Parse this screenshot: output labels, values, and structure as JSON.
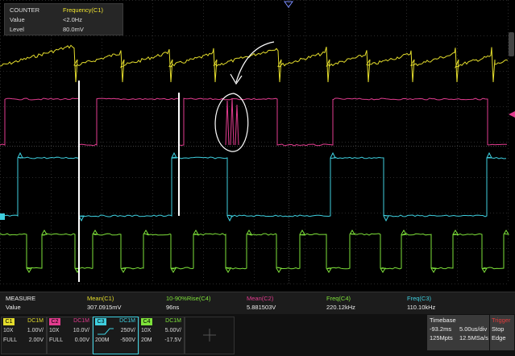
{
  "colors": {
    "c1": "#e3dc2c",
    "c2": "#e23c8f",
    "c3": "#3fd0e0",
    "c4": "#7ee23a",
    "bg": "#000000"
  },
  "counter": {
    "title": "COUNTER",
    "source": "Frequency(C1)",
    "value_label": "Value",
    "value": "<2.0Hz",
    "level_label": "Level",
    "level": "80.0mV"
  },
  "measure": {
    "title": "MEASURE",
    "row_label": "Value",
    "items": [
      {
        "name": "Mean(C1)",
        "value": "307.0915mV"
      },
      {
        "name": "10-90%Rise(C4)",
        "value": "96ns"
      },
      {
        "name": "Mean(C2)",
        "value": "5.881503V"
      },
      {
        "name": "Freq(C4)",
        "value": "220.12kHz"
      },
      {
        "name": "Freq(C3)",
        "value": "110.10kHz"
      }
    ]
  },
  "channels": [
    {
      "tag": "C1",
      "coupling": "DC1M",
      "probe": "10X",
      "scale": "1.00V/",
      "bw": "FULL",
      "offset": "2.00V"
    },
    {
      "tag": "C2",
      "coupling": "DC1M",
      "probe": "10X",
      "scale": "10.0V/",
      "bw": "FULL",
      "offset": "0.00V"
    },
    {
      "tag": "C3",
      "coupling": "DC1M",
      "probe": "",
      "scale": "250V/",
      "bw": "200M",
      "offset": "-500V"
    },
    {
      "tag": "C4",
      "coupling": "DC1M",
      "probe": "10X",
      "scale": "5.00V/",
      "bw": "20M",
      "offset": "-17.5V"
    }
  ],
  "timebase": {
    "title": "Timebase",
    "delay": "-93.2ms",
    "scale": "5.00us/div",
    "points": "125Mpts",
    "rate": "12.5MSa/s"
  },
  "trigger": {
    "title": "Trigger",
    "state": "Stop",
    "type": "Edge"
  }
}
